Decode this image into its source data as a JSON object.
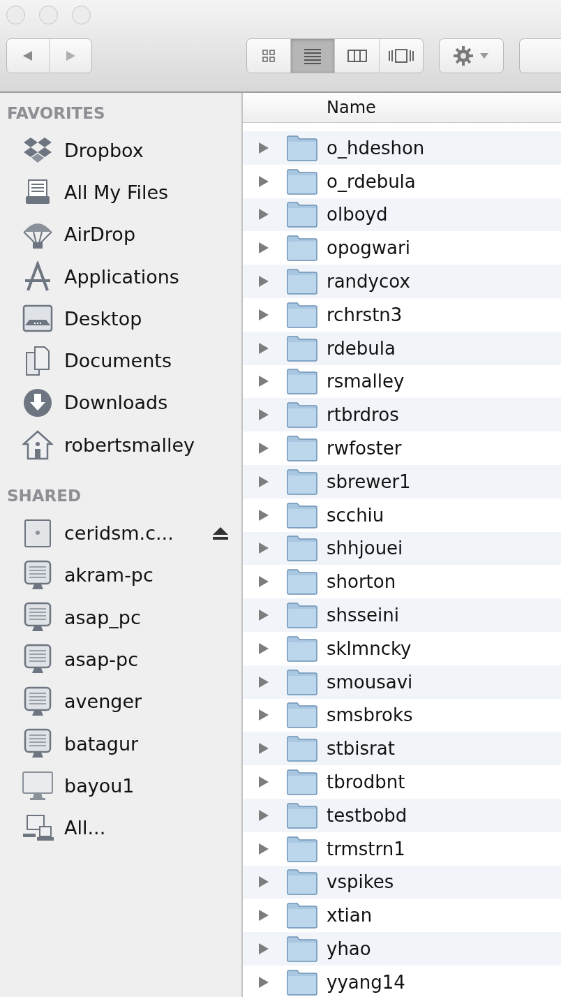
{
  "toolbar": {
    "view_modes": [
      {
        "kind": "icons",
        "selected": false
      },
      {
        "kind": "list",
        "selected": true
      },
      {
        "kind": "columns",
        "selected": false
      },
      {
        "kind": "coverflow",
        "selected": false
      }
    ]
  },
  "sidebar": {
    "sections": [
      {
        "title": "FAVORITES",
        "items": [
          {
            "label": "Dropbox",
            "kind": "dropbox"
          },
          {
            "label": "All My Files",
            "kind": "files"
          },
          {
            "label": "AirDrop",
            "kind": "airdrop"
          },
          {
            "label": "Applications",
            "kind": "apps"
          },
          {
            "label": "Desktop",
            "kind": "desktop"
          },
          {
            "label": "Documents",
            "kind": "documents"
          },
          {
            "label": "Downloads",
            "kind": "downloads"
          },
          {
            "label": "robertsmalley",
            "kind": "home"
          }
        ]
      },
      {
        "title": "SHARED",
        "items": [
          {
            "label": "ceridsm.c...",
            "kind": "server",
            "ejectable": true
          },
          {
            "label": "akram-pc",
            "kind": "pc"
          },
          {
            "label": "asap_pc",
            "kind": "pc"
          },
          {
            "label": "asap-pc",
            "kind": "pc"
          },
          {
            "label": "avenger",
            "kind": "pc"
          },
          {
            "label": "batagur",
            "kind": "pc"
          },
          {
            "label": "bayou1",
            "kind": "imac"
          },
          {
            "label": "All...",
            "kind": "network"
          }
        ]
      }
    ]
  },
  "table": {
    "columns": [
      "Name"
    ],
    "rows": [
      "o_hdeshon",
      "o_rdebula",
      "olboyd",
      "opogwari",
      "randycox",
      "rchrstn3",
      "rdebula",
      "rsmalley",
      "rtbrdros",
      "rwfoster",
      "sbrewer1",
      "scchiu",
      "shhjouei",
      "shorton",
      "shsseini",
      "sklmncky",
      "smousavi",
      "smsbroks",
      "stbisrat",
      "tbrodbnt",
      "testbobd",
      "trmstrn1",
      "vspikes",
      "xtian",
      "yhao",
      "yyang14"
    ]
  }
}
